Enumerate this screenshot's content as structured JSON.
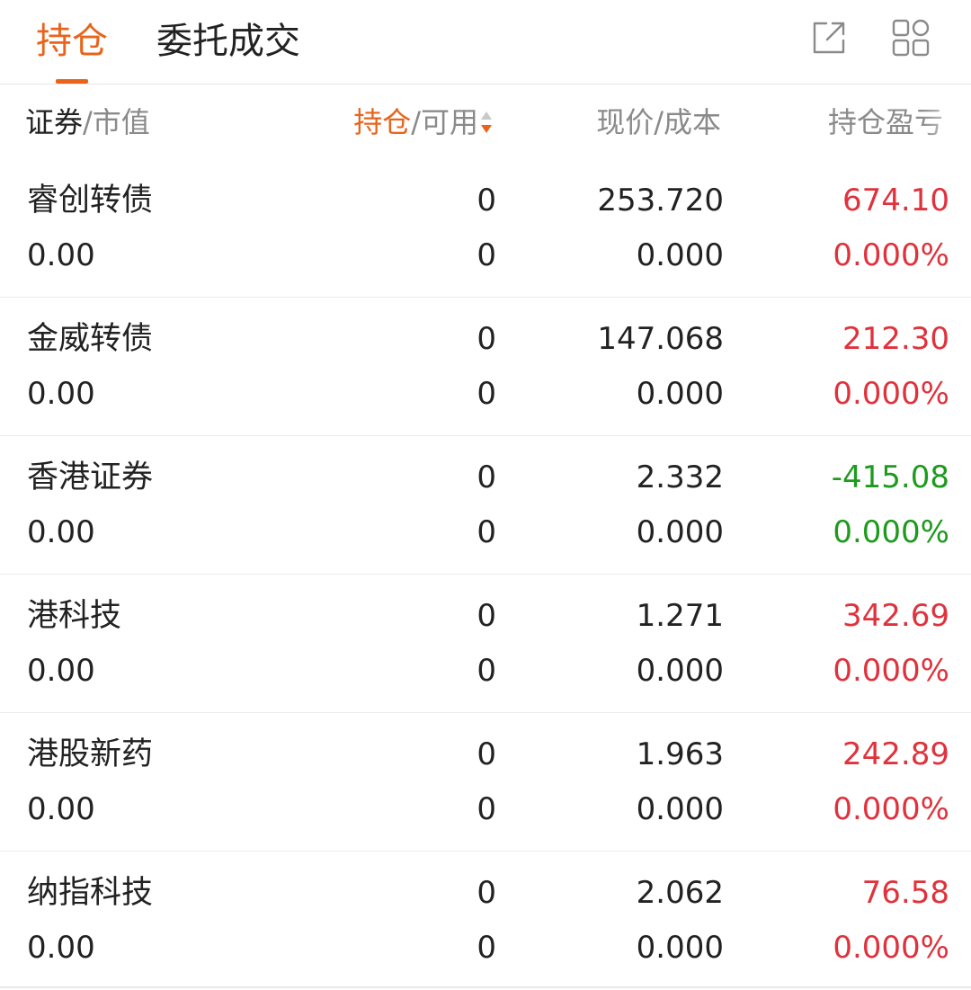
{
  "tabs": {
    "holdings": "持仓",
    "orders": "委托成交"
  },
  "icons": {
    "export": "external-link-icon",
    "grid": "grid-apps-icon"
  },
  "colors": {
    "accent": "#e8641c",
    "up": "#e0323c",
    "down": "#1e9a1e"
  },
  "columns": {
    "security": "证券",
    "market_value": "/市值",
    "holdings": "持仓",
    "available": "/可用",
    "price_cost": "现价/成本",
    "profit_loss": "持仓盈亏"
  },
  "positions": [
    {
      "name": "睿创转债",
      "market_value": "0.00",
      "holding": "0",
      "available": "0",
      "price": "253.720",
      "cost": "0.000",
      "pl": "674.10",
      "pl_pct": "0.000%",
      "direction": "up"
    },
    {
      "name": "金威转债",
      "market_value": "0.00",
      "holding": "0",
      "available": "0",
      "price": "147.068",
      "cost": "0.000",
      "pl": "212.30",
      "pl_pct": "0.000%",
      "direction": "up"
    },
    {
      "name": "香港证券",
      "market_value": "0.00",
      "holding": "0",
      "available": "0",
      "price": "2.332",
      "cost": "0.000",
      "pl": "-415.08",
      "pl_pct": "0.000%",
      "direction": "down"
    },
    {
      "name": "港科技",
      "market_value": "0.00",
      "holding": "0",
      "available": "0",
      "price": "1.271",
      "cost": "0.000",
      "pl": "342.69",
      "pl_pct": "0.000%",
      "direction": "up"
    },
    {
      "name": "港股新药",
      "market_value": "0.00",
      "holding": "0",
      "available": "0",
      "price": "1.963",
      "cost": "0.000",
      "pl": "242.89",
      "pl_pct": "0.000%",
      "direction": "up"
    },
    {
      "name": "纳指科技",
      "market_value": "0.00",
      "holding": "0",
      "available": "0",
      "price": "2.062",
      "cost": "0.000",
      "pl": "76.58",
      "pl_pct": "0.000%",
      "direction": "up"
    }
  ]
}
